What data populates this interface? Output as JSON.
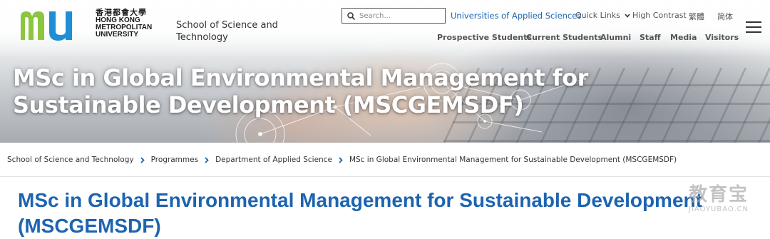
{
  "brand": {
    "logo_letters": "mu",
    "name_cn": "香港都會大學",
    "name_en_lines": [
      "HONG KONG",
      "METROPOLITAN",
      "UNIVERSITY"
    ],
    "green": "#8cc63f",
    "blue": "#1e8fd6"
  },
  "header": {
    "school_name": "School of Science and Technology",
    "search_placeholder": "Search...",
    "utility_links": {
      "uas": "Universities of Applied Sciences",
      "quick_links": "Quick Links",
      "high_contrast": "High Contrast",
      "traditional_chinese": "繁體",
      "simplified_chinese": "简体"
    },
    "main_nav": {
      "prospective": "Prospective Students",
      "current": "Current Students",
      "alumni": "Alumni",
      "staff": "Staff",
      "media": "Media",
      "visitors": "Visitors"
    }
  },
  "hero": {
    "title": "MSc in Global Environmental Management for Sustainable Development (MSCGEMSDF)"
  },
  "breadcrumb": {
    "items": [
      "School of Science and Technology",
      "Programmes",
      "Department of Applied Science",
      "MSc in Global Environmental Management for Sustainable Development (MSCGEMSDF)"
    ]
  },
  "page": {
    "title": "MSc in Global Environmental Management for Sustainable Development (MSCGEMSDF)"
  },
  "watermark": {
    "cn": "教育宝",
    "en": "JIAOYUBAO.CN"
  },
  "colors": {
    "link_blue": "#1d64b0",
    "chevron_blue": "#1d64b0",
    "text_grey": "#555555"
  }
}
